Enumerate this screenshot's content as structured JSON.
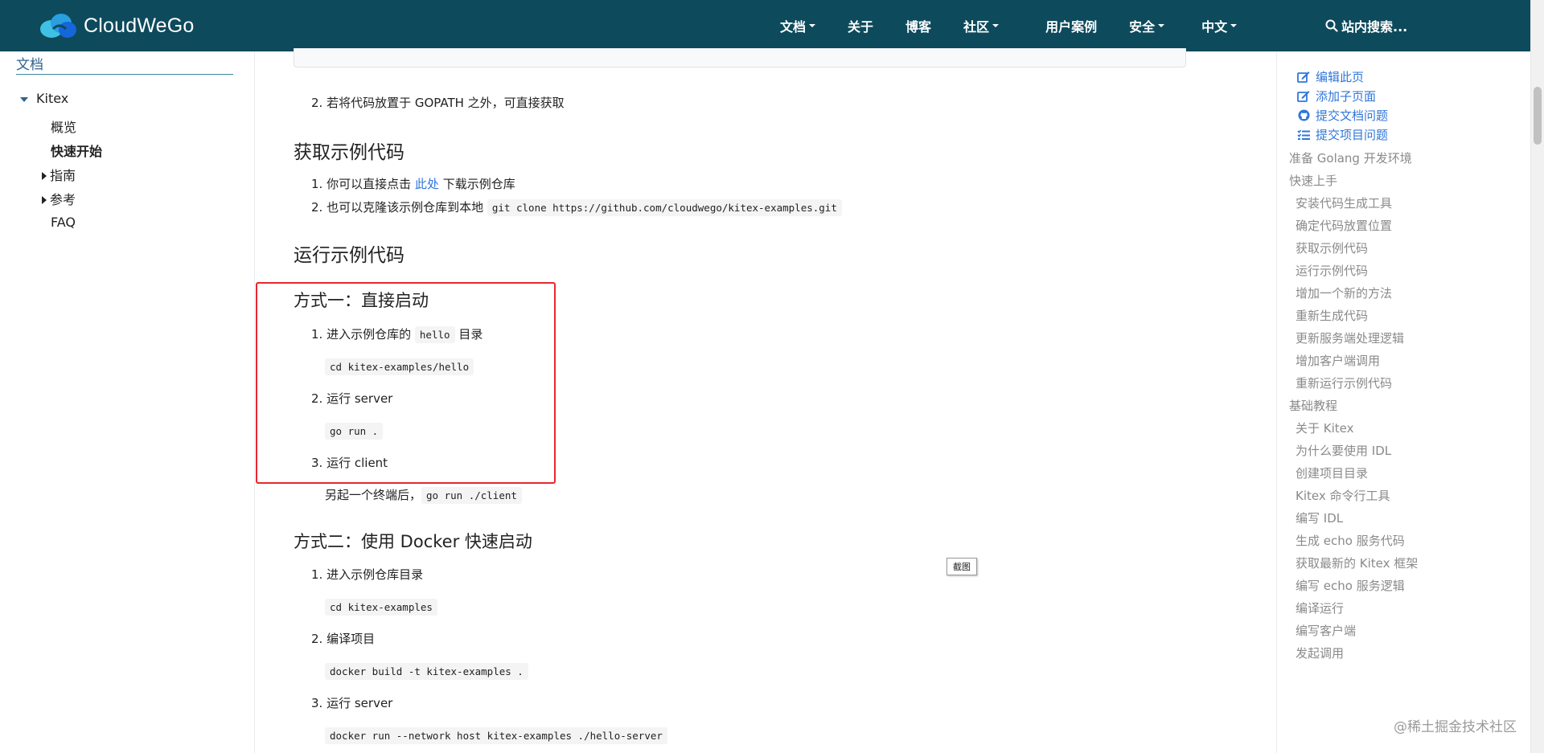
{
  "navbar": {
    "brand": "CloudWeGo",
    "items": [
      {
        "label": "文档",
        "dropdown": true
      },
      {
        "label": "关于",
        "dropdown": false
      },
      {
        "label": "博客",
        "dropdown": false
      },
      {
        "label": "社区",
        "dropdown": true
      },
      {
        "label": "用户案例",
        "dropdown": false
      },
      {
        "label": "安全",
        "dropdown": true
      },
      {
        "label": "中文",
        "dropdown": true
      }
    ],
    "search_placeholder": "站内搜索...",
    "colors": {
      "background": "#0d4a5c",
      "logo_light": "#3fc1e6",
      "logo_dark": "#1566d8"
    }
  },
  "left_sidebar": {
    "title": "文档",
    "section": "Kitex",
    "items": [
      {
        "label": "概览",
        "bold": false
      },
      {
        "label": "快速开始",
        "bold": true
      },
      {
        "label": "指南",
        "expandable": true
      },
      {
        "label": "参考",
        "expandable": true
      },
      {
        "label": "FAQ",
        "bold": false
      }
    ]
  },
  "main": {
    "item_gopath": "若将代码放置于 GOPATH 之外，可直接获取",
    "h_get_example": "获取示例代码",
    "get_step1_prefix": "你可以直接点击",
    "get_step1_link": "此处",
    "get_step1_suffix": "下载示例仓库",
    "get_step2_prefix": "也可以克隆该示例仓库到本地",
    "get_step2_code": "git clone https://github.com/cloudwego/kitex-examples.git",
    "h_run_example": "运行示例代码",
    "h_method1": "方式一：直接启动",
    "m1_step1_prefix": "进入示例仓库的",
    "m1_step1_code": "hello",
    "m1_step1_suffix": "目录",
    "m1_step1_cmd": "cd kitex-examples/hello",
    "m1_step2": "运行 server",
    "m1_step2_cmd": "go run .",
    "m1_step3": "运行 client",
    "m1_step3_prefix": "另起一个终端后，",
    "m1_step3_cmd": "go run ./client",
    "h_method2": "方式二：使用 Docker 快速启动",
    "m2_step1": "进入示例仓库目录",
    "m2_step1_cmd": "cd kitex-examples",
    "m2_step2": "编译项目",
    "m2_step2_cmd": "docker build -t kitex-examples .",
    "m2_step3": "运行 server",
    "m2_step3_cmd": "docker run --network host kitex-examples ./hello-server",
    "screenshot_tag": "截图",
    "highlight_color": "#e8272f"
  },
  "right_sidebar": {
    "actions": [
      {
        "label": "编辑此页",
        "icon": "edit-icon"
      },
      {
        "label": "添加子页面",
        "icon": "edit-icon"
      },
      {
        "label": "提交文档问题",
        "icon": "github-icon"
      },
      {
        "label": "提交项目问题",
        "icon": "tasks-icon"
      }
    ],
    "toc": [
      {
        "label": "准备 Golang 开发环境",
        "level": 1
      },
      {
        "label": "快速上手",
        "level": 1
      },
      {
        "label": "安装代码生成工具",
        "level": 2
      },
      {
        "label": "确定代码放置位置",
        "level": 2
      },
      {
        "label": "获取示例代码",
        "level": 2
      },
      {
        "label": "运行示例代码",
        "level": 2
      },
      {
        "label": "增加一个新的方法",
        "level": 2
      },
      {
        "label": "重新生成代码",
        "level": 2
      },
      {
        "label": "更新服务端处理逻辑",
        "level": 2
      },
      {
        "label": "增加客户端调用",
        "level": 2
      },
      {
        "label": "重新运行示例代码",
        "level": 2
      },
      {
        "label": "基础教程",
        "level": 1
      },
      {
        "label": "关于 Kitex",
        "level": 2
      },
      {
        "label": "为什么要使用 IDL",
        "level": 2
      },
      {
        "label": "创建项目目录",
        "level": 2
      },
      {
        "label": "Kitex 命令行工具",
        "level": 2
      },
      {
        "label": "编写 IDL",
        "level": 2
      },
      {
        "label": "生成 echo 服务代码",
        "level": 2
      },
      {
        "label": "获取最新的 Kitex 框架",
        "level": 2
      },
      {
        "label": "编写 echo 服务逻辑",
        "level": 2
      },
      {
        "label": "编译运行",
        "level": 2
      },
      {
        "label": "编写客户端",
        "level": 2
      },
      {
        "label": "发起调用",
        "level": 2
      }
    ]
  },
  "watermark": "@稀土掘金技术社区"
}
